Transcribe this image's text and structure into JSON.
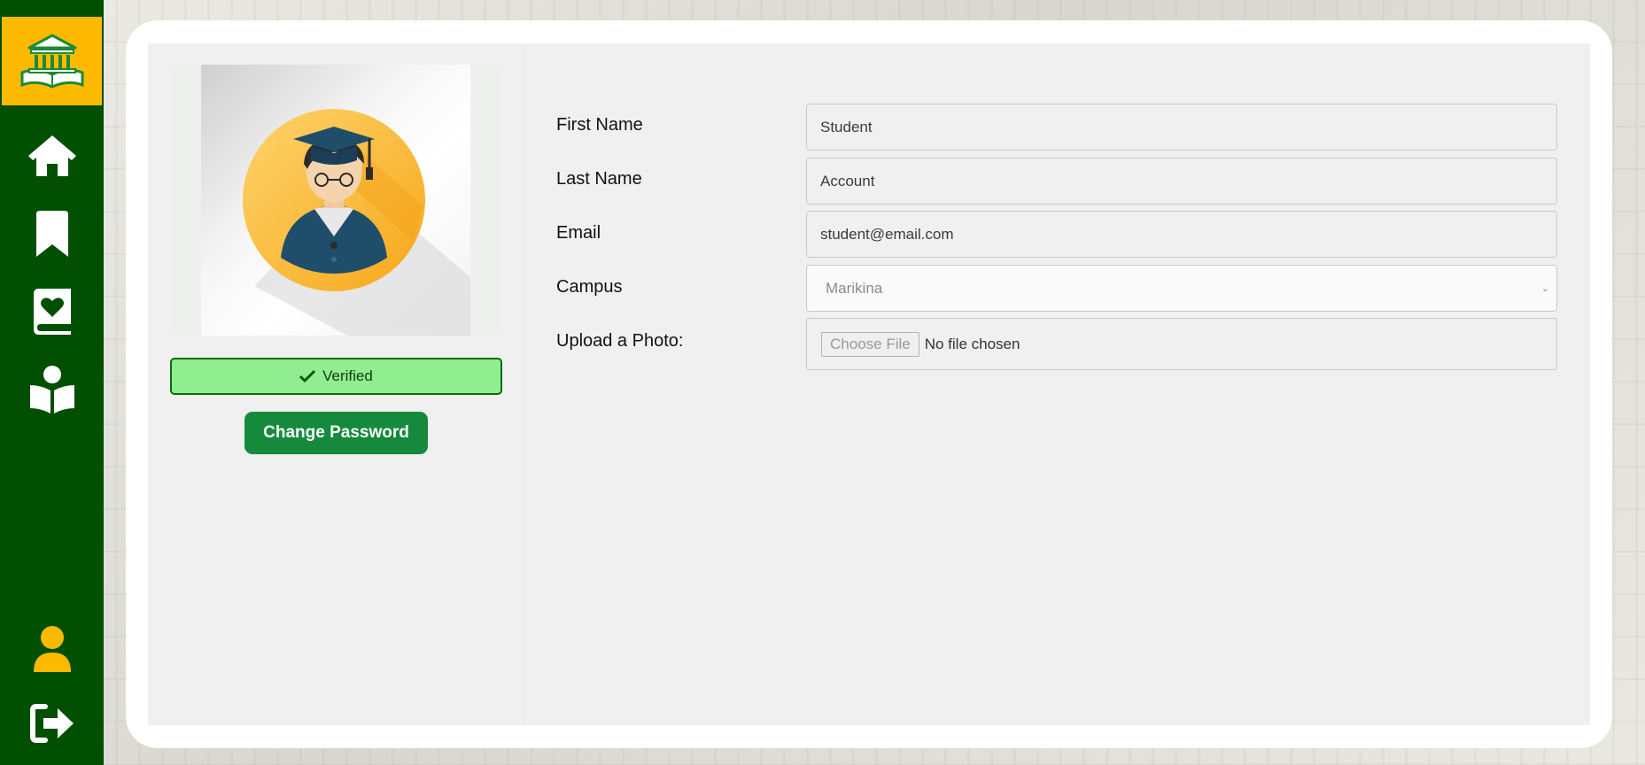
{
  "sidebar": {
    "logo_icon": "library-building-book-icon",
    "items": [
      {
        "icon": "home-icon"
      },
      {
        "icon": "bookmark-icon"
      },
      {
        "icon": "book-heart-icon"
      },
      {
        "icon": "reader-icon"
      }
    ],
    "bottom": [
      {
        "icon": "user-icon",
        "color": "#fdba00"
      },
      {
        "icon": "logout-icon",
        "color": "#ffffff"
      }
    ]
  },
  "profile": {
    "avatar_icon": "graduate-avatar-icon",
    "verified_label": "Verified",
    "change_password_label": "Change Password"
  },
  "form": {
    "first_name_label": "First Name",
    "first_name_value": "Student",
    "last_name_label": "Last Name",
    "last_name_value": "Account",
    "email_label": "Email",
    "email_value": "student@email.com",
    "campus_label": "Campus",
    "campus_value": "Marikina",
    "upload_label": "Upload a Photo:",
    "upload_button": "Choose File",
    "upload_status": "No file chosen"
  },
  "colors": {
    "sidebar": "#014f01",
    "accent": "#fdba00",
    "verified_bg": "#90ee90",
    "button": "#158a3c"
  }
}
